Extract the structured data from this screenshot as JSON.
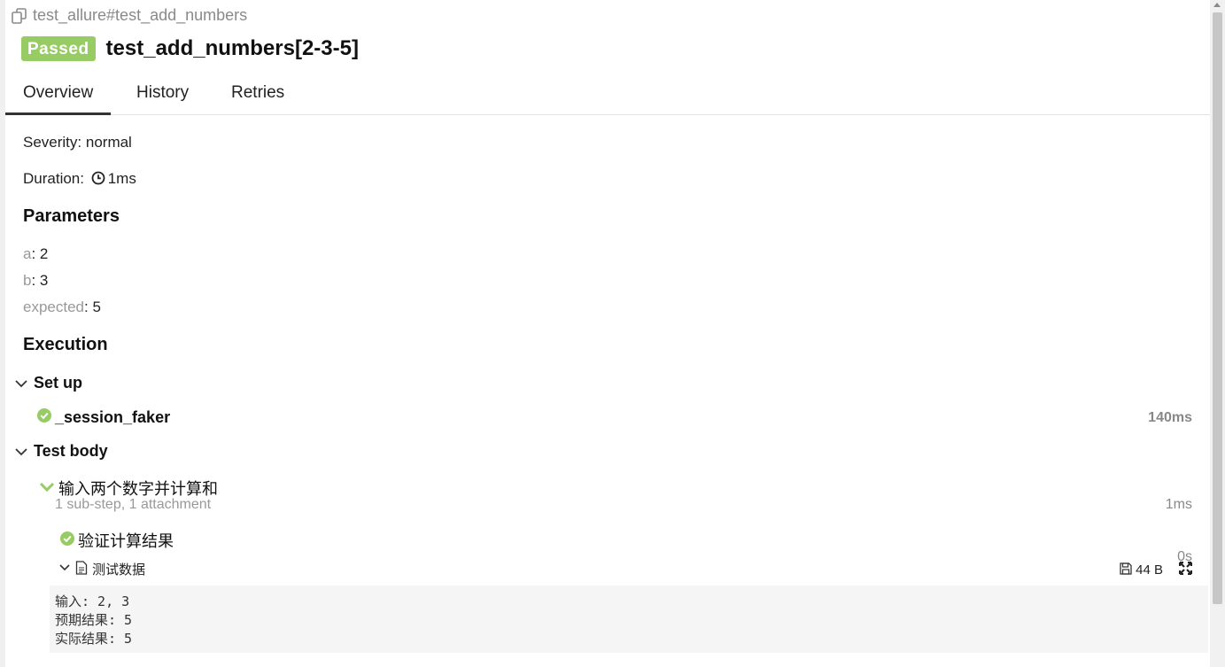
{
  "header": {
    "breadcrumb": "test_allure#test_add_numbers",
    "status": "Passed",
    "title": "test_add_numbers[2-3-5]",
    "status_color": "#97cc64"
  },
  "tabs": [
    {
      "label": "Overview",
      "active": true
    },
    {
      "label": "History",
      "active": false
    },
    {
      "label": "Retries",
      "active": false
    }
  ],
  "overview": {
    "severity_label": "Severity:",
    "severity_value": "normal",
    "duration_label": "Duration:",
    "duration_value": "1ms"
  },
  "parameters": {
    "heading": "Parameters",
    "items": [
      {
        "name": "a",
        "value": "2"
      },
      {
        "name": "b",
        "value": "3"
      },
      {
        "name": "expected",
        "value": "5"
      }
    ]
  },
  "execution": {
    "heading": "Execution",
    "setup": {
      "label": "Set up",
      "steps": [
        {
          "name": "_session_faker",
          "time": "140ms"
        }
      ]
    },
    "test_body": {
      "label": "Test body",
      "step": {
        "name": "输入两个数字并计算和",
        "summary": "1 sub-step, 1 attachment",
        "time": "1ms",
        "sub_step": {
          "name": "验证计算结果",
          "time": "0s"
        },
        "attachment": {
          "name": "测试数据",
          "size": "44 B",
          "lines": [
            "输入: 2, 3",
            "预期结果: 5",
            "实际结果: 5"
          ]
        }
      }
    }
  }
}
